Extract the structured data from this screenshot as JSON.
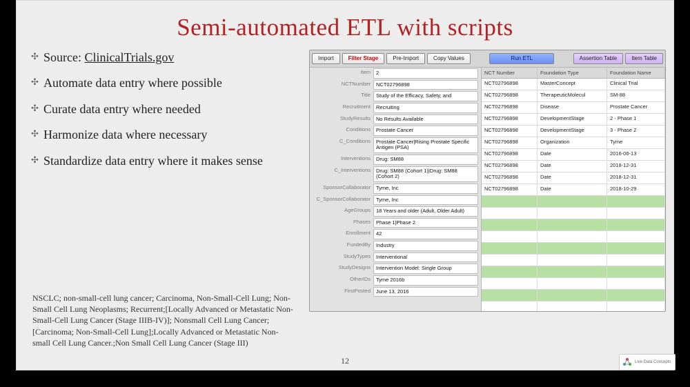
{
  "title": "Semi-automated ETL with scripts",
  "bullets": [
    {
      "prefix": "Source: ",
      "link": "ClinicalTrials.gov"
    },
    {
      "text": "Automate data entry where possible"
    },
    {
      "text": "Curate data entry where needed"
    },
    {
      "text": "Harmonize data where necessary"
    },
    {
      "text": "Standardize data entry where it makes sense"
    }
  ],
  "footnote": "NSCLC; non-small-cell lung cancer; Carcinoma, Non-Small-Cell Lung; Non-Small Cell Lung Neoplasms; Recurrent;[Locally Advanced or Metastatic Non-Small-Cell Lung Cancer (Stage IIIB-IV)]; Nonsmall Cell Lung Cancer;[Carcinoma; Non-Small-Cell Lung];Locally Advanced or Metastatic Non-small Cell Lung Cancer.;Non Small Cell Lung Cancer (Stage III)",
  "page_number": "12",
  "toolbar": {
    "import": "Import",
    "filter_stage": "Filter Stage",
    "pre_import": "Pre-Import",
    "copy_values": "Copy Values",
    "run_etl": "Run ETL",
    "assertion_table": "Assertion Table",
    "item_table": "Item Table"
  },
  "form": [
    {
      "label": "Item",
      "value": "2"
    },
    {
      "label": "NCTNumber",
      "value": "NCT02796898"
    },
    {
      "label": "Title",
      "value": "Study of the Efficacy, Safety, and"
    },
    {
      "label": "Recruitment",
      "value": "Recruiting"
    },
    {
      "label": "StudyResults",
      "value": "No Results Available"
    },
    {
      "label": "Conditions",
      "value": "Prostate Cancer"
    },
    {
      "label": "C_Conditions",
      "value": "Prostate Cancer|Rising Prostate Specific Antigen (PSA)"
    },
    {
      "label": "Interventions",
      "value": "Drug: SM88"
    },
    {
      "label": "C_Interventions",
      "value": "Drug: SM88 (Cohort 1)|Drug: SM88 (Cohort 2)"
    },
    {
      "label": "SponsorCollaborator",
      "value": "Tyme, Inc"
    },
    {
      "label": "C_SponsorCollaborator",
      "value": "Tyme, Inc"
    },
    {
      "label": "AgeGroups",
      "value": "18 Years and older  (Adult, Older Adult)"
    },
    {
      "label": "Phases",
      "value": "Phase 1|Phase 2"
    },
    {
      "label": "Enrollment",
      "value": "42"
    },
    {
      "label": "FundedBy",
      "value": "Industry"
    },
    {
      "label": "StudyTypes",
      "value": "Interventional"
    },
    {
      "label": "StudyDesigns",
      "value": "Intervention Model: Single Group"
    },
    {
      "label": "OtherIDs",
      "value": "Tyme 2016b"
    },
    {
      "label": "FirstPosted",
      "value": "June 13, 2016"
    }
  ],
  "grid": {
    "headers": [
      "NCT Number",
      "Foundation Type",
      "Foundation Name"
    ],
    "rows": [
      {
        "nct": "NCT02796898",
        "type": "MasterConcept",
        "name": "Clinical Trial"
      },
      {
        "nct": "NCT02796898",
        "type": "TherapeuticMolecul",
        "name": "SM-88"
      },
      {
        "nct": "NCT02796898",
        "type": "Disease",
        "name": "Prostate Cancer"
      },
      {
        "nct": "NCT02796898",
        "type": "DevelopmentStage",
        "name": "2 - Phase 1"
      },
      {
        "nct": "NCT02796898",
        "type": "DevelopmentStage",
        "name": "3 - Phase 2"
      },
      {
        "nct": "NCT02796898",
        "type": "Organization",
        "name": "Tyme"
      },
      {
        "nct": "NCT02796898",
        "type": "Date",
        "name": "2016-06-13"
      },
      {
        "nct": "NCT02796898",
        "type": "Date",
        "name": "2018-12-31"
      },
      {
        "nct": "NCT02796898",
        "type": "Date",
        "name": "2018-12-31"
      },
      {
        "nct": "NCT02796898",
        "type": "Date",
        "name": "2018-10-29"
      }
    ],
    "blank_rows": 11
  },
  "watermark": "Live Data Concepts"
}
